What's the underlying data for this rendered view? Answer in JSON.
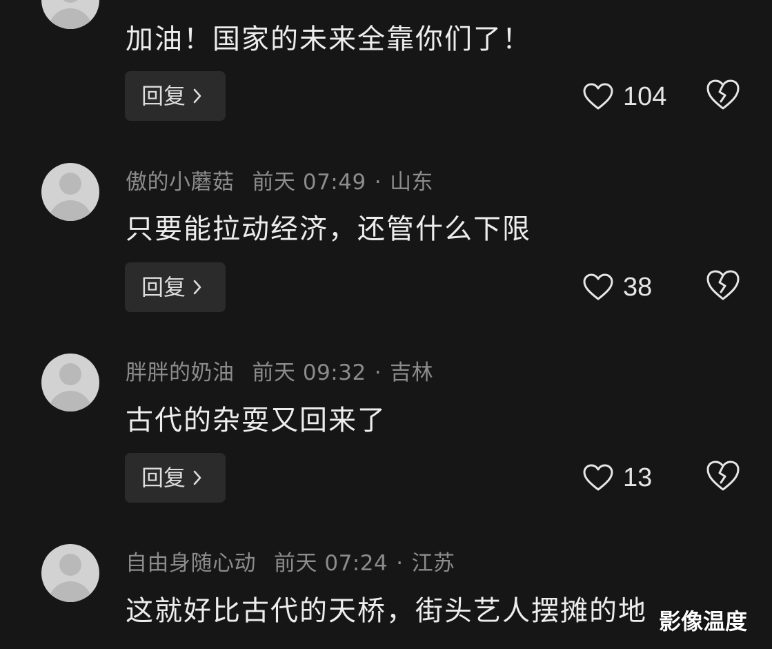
{
  "comments": [
    {
      "username": "",
      "time": "",
      "location": "",
      "text": "加油！国家的未来全靠你们了！",
      "reply_label": "回复",
      "likes": "104"
    },
    {
      "username": "傲的小蘑菇",
      "time": "前天 07:49",
      "location": "山东",
      "text": "只要能拉动经济，还管什么下限",
      "reply_label": "回复",
      "likes": "38"
    },
    {
      "username": "胖胖的奶油",
      "time": "前天 09:32",
      "location": "吉林",
      "text": "古代的杂耍又回来了",
      "reply_label": "回复",
      "likes": "13"
    },
    {
      "username": "自由身随心动",
      "time": "前天 07:24",
      "location": "江苏",
      "text": "这就好比古代的天桥，街头艺人摆摊的地",
      "reply_label": "回复",
      "likes": ""
    }
  ],
  "separator": "·",
  "watermark": "影像温度",
  "icons": {
    "like": "heart-outline-icon",
    "dislike": "broken-heart-icon",
    "reply_chevron": "chevron-right-icon",
    "avatar": "default-avatar-icon"
  },
  "colors": {
    "background": "#161616",
    "text_primary": "#ededed",
    "text_secondary": "#8c8c8c",
    "button_bg": "#2b2b2b"
  }
}
